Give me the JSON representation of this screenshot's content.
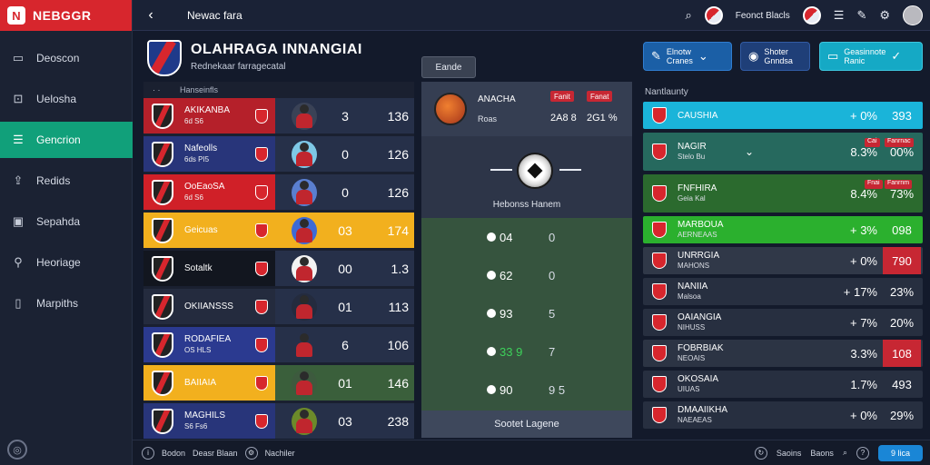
{
  "app": {
    "logo_text": "NEBGGR",
    "logo_mark": "N"
  },
  "sidebar": {
    "items": [
      {
        "label": "Deoscon",
        "icon": "monitor-icon"
      },
      {
        "label": "Uelosha",
        "icon": "chart-icon"
      },
      {
        "label": "Gencrion",
        "icon": "list-icon",
        "active": true
      },
      {
        "label": "Redids",
        "icon": "upload-icon"
      },
      {
        "label": "Sepahda",
        "icon": "image-icon"
      },
      {
        "label": "Heoriage",
        "icon": "pin-icon"
      },
      {
        "label": "Marpiths",
        "icon": "document-icon"
      }
    ]
  },
  "topbar": {
    "back": "‹",
    "title": "Newac fara",
    "user_label": "Feonct Blacls"
  },
  "header": {
    "title": "OLAHRAGA INNANGIAI",
    "subtitle": "Rednekaar farragecatal",
    "center_button": "Eande"
  },
  "quick_buttons": [
    {
      "line1": "Elnotw",
      "line2": "Cranes",
      "icon": "pen-icon",
      "trail": "⌄"
    },
    {
      "line1": "Shoter",
      "line2": "Gnndsa",
      "icon": "user-icon"
    },
    {
      "line1": "Geasinnote",
      "line2": "Ranic",
      "icon": "tablet-icon",
      "trail": "✓"
    }
  ],
  "left_table": {
    "header": "Hanseinfls",
    "rows": [
      {
        "name": "AKIKANBA",
        "sub": "6d  S6",
        "v1": "3",
        "v2": "136",
        "band": "#b5202a",
        "player_bg": "#3a4256"
      },
      {
        "name": "Nafeolls",
        "sub": "6ds  PI5",
        "v1": "0",
        "v2": "126",
        "band": "#28357a",
        "player_bg": "#7ec8e6"
      },
      {
        "name": "OoEaoSA",
        "sub": "6d  S6",
        "v1": "0",
        "v2": "126",
        "band": "#d02028",
        "player_bg": "#5a7fd0"
      },
      {
        "name": "Geicuas",
        "sub": "",
        "v1": "03",
        "v2": "174",
        "band": "#f2b01e",
        "player_bg": "#3e6ad6",
        "row_bg": "#f2b01e",
        "mark": "O"
      },
      {
        "name": "Sotaltk",
        "sub": "",
        "v1": "00",
        "v2": "1.3",
        "band": "#12161f",
        "player_bg": "#f2f2f2"
      },
      {
        "name": "OKIIANSSS",
        "sub": "",
        "v1": "01",
        "v2": "113",
        "band": "#242b3e",
        "player_bg": "#242b3e"
      },
      {
        "name": "RODAFIEA",
        "sub": "OS  HLS",
        "v1": "6",
        "v2": "106",
        "band": "#2b3a90",
        "player_bg": "#263049"
      },
      {
        "name": "BAIIAIA",
        "sub": "",
        "v1": "01",
        "v2": "146",
        "band": "#f2b01e",
        "player_bg": "#3d5a3e",
        "row_bg": "#3a5f3b"
      },
      {
        "name": "MAGHILS",
        "sub": "S6  Fs6",
        "v1": "03",
        "v2": "238",
        "band": "#28357a",
        "player_bg": "#6c8a2a"
      }
    ]
  },
  "mid_panel": {
    "top_name": "ANACHA",
    "top_sub": "Roas",
    "pill1": "Fanit",
    "pill2": "Fanat",
    "score1": "2A8  8",
    "score2": "2G1 %",
    "hero_label": "Hebonss Hanem",
    "rows": [
      {
        "a": "04",
        "b": "0"
      },
      {
        "a": "62",
        "b": "0"
      },
      {
        "a": "93",
        "b": "5"
      },
      {
        "a": "33  9",
        "b": "7",
        "highlight": true
      },
      {
        "a": "90",
        "b": "9 5"
      }
    ],
    "footer": "Sootet Lagene"
  },
  "right_panel": {
    "header": "Nantlaunty",
    "rows": [
      {
        "name": "CAUSHIA",
        "sub": "",
        "p1": "+ 0%",
        "p2": "393",
        "bg": "#1ab4d9",
        "p2bg": ""
      },
      {
        "name": "NAGIR",
        "sub": "Stelo Bu",
        "p1": "8.3%",
        "p2": "00%",
        "bg": "#26695e",
        "tall": true,
        "tag1": "Cai",
        "tag2": "Fanrnac",
        "chev": "⌄"
      },
      {
        "name": "FNFHIRA",
        "sub": "Geia  Kal",
        "p1": "8.4%",
        "p2": "73%",
        "bg": "#2b6a2e",
        "tall": true,
        "tag1": "Fnai",
        "tag2": "Fanrnm"
      },
      {
        "name": "MARBOUA",
        "sub": "AERNEAAS",
        "p1": "+ 3%",
        "p2": "098",
        "bg": "#2bb02e"
      },
      {
        "name": "UNRRGIA",
        "sub": "MAHONS",
        "p1": "+ 0%",
        "p2": "790",
        "bg": "#303848",
        "p2bg": "#c72733"
      },
      {
        "name": "NANIIA",
        "sub": "Malsoa",
        "p1": "+ 17%",
        "p2": "23%",
        "bg": "#272f40"
      },
      {
        "name": "OAIANGIA",
        "sub": "NIHUSS",
        "p1": "+ 7%",
        "p2": "20%",
        "bg": "#272f40"
      },
      {
        "name": "FOBRBIAK",
        "sub": "NEOAIS",
        "p1": "3.3%",
        "p2": "108",
        "bg": "#2c3444",
        "p2bg": "#c72733"
      },
      {
        "name": "OKOSAIA",
        "sub": "UIUAS",
        "p1": "1.7%",
        "p2": "493",
        "bg": "#272f40"
      },
      {
        "name": "DMAAIIKHA",
        "sub": "NAEAEAS",
        "p1": "+ 0%",
        "p2": "29%",
        "bg": "#272f40"
      }
    ]
  },
  "bottombar": {
    "left1": "Bodon",
    "left2": "Deasr Blaan",
    "left3": "Nachiler",
    "right1": "Saoins",
    "right2": "Baons",
    "button": "9 lica"
  }
}
